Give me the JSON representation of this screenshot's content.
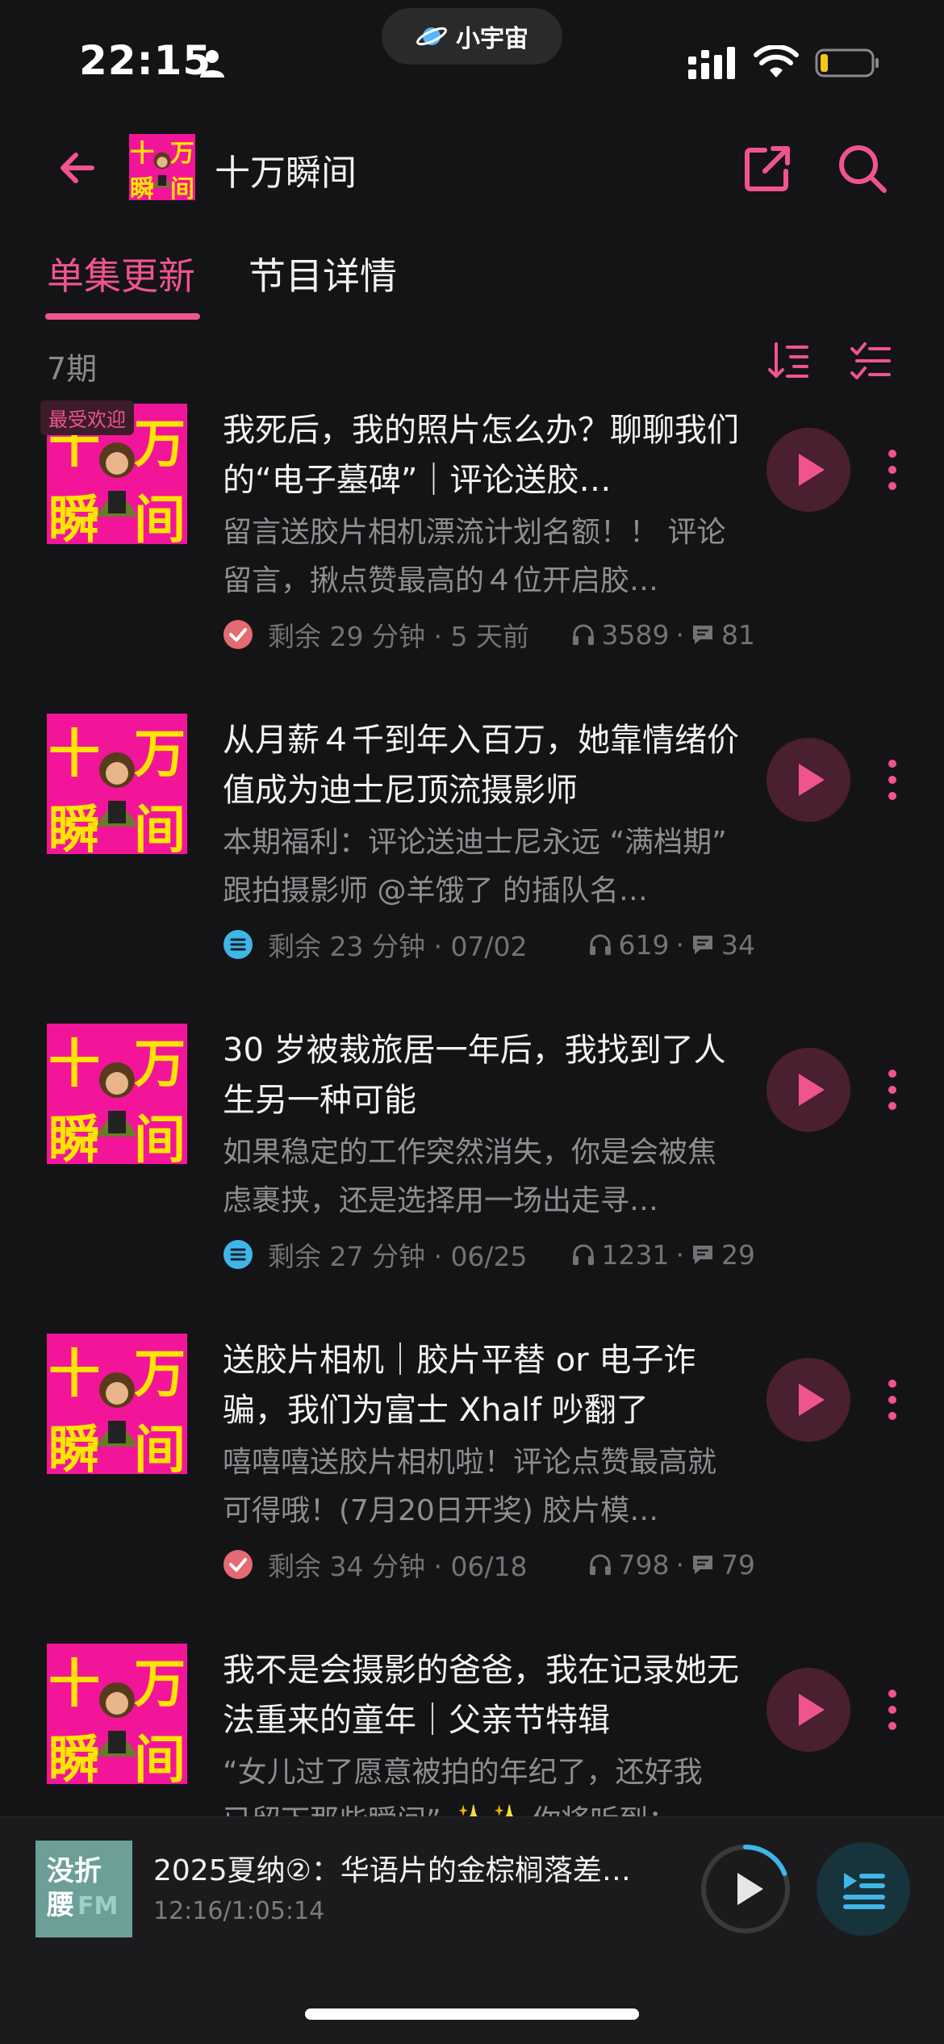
{
  "status_bar": {
    "time": "22:15",
    "island_label": "小宇宙"
  },
  "header": {
    "title": "十万瞬间",
    "logo_text": [
      "十",
      "万",
      "瞬",
      "间"
    ]
  },
  "tabs": [
    {
      "label": "单集更新",
      "active": true
    },
    {
      "label": "节目详情",
      "active": false
    }
  ],
  "episode_count": "7期",
  "accent_color": "#f0548e",
  "episodes": [
    {
      "badge": "最受欢迎",
      "title": "我死后，我的照片怎么办？聊聊我们的“电子墓碑”｜评论送胶…",
      "desc": "留言送胶片相机漂流计划名额！！ 评论留言，揪点赞最高的４位开启胶…",
      "status": "check",
      "remain": "剩余 29 分钟 · 5 天前",
      "plays": "3589",
      "comments": "81"
    },
    {
      "title": "从月薪４千到年入百万，她靠情绪价值成为迪士尼顶流摄影师",
      "desc": "本期福利：评论送迪士尼永远 “满档期” 跟拍摄影师 @羊饿了 的插队名…",
      "status": "list",
      "remain": "剩余 23 分钟 · 07/02",
      "plays": "619",
      "comments": "34"
    },
    {
      "title": "30 岁被裁旅居一年后，我找到了人生另一种可能",
      "desc": "如果稳定的工作突然消失，你是会被焦虑裹挟，还是选择用一场出走寻…",
      "status": "list",
      "remain": "剩余 27 分钟 · 06/25",
      "plays": "1231",
      "comments": "29"
    },
    {
      "title": "送胶片相机｜胶片平替 or 电子诈骗，我们为富士 Xhalf 吵翻了",
      "desc": "嘻嘻嘻送胶片相机啦！评论点赞最高就可得哦！(7月20日开奖) 胶片模…",
      "status": "check",
      "remain": "剩余 34 分钟 · 06/18",
      "plays": "798",
      "comments": "79"
    },
    {
      "title": "我不是会摄影的爸爸，我在记录她无法重来的童年｜父亲节特辑",
      "desc": "“女儿过了愿意被拍的年纪了，还好我已留下那些瞬间” ✨✨ 你将听到：",
      "status": "",
      "remain": "",
      "plays": "",
      "comments": ""
    }
  ],
  "player": {
    "cover_text": [
      "没折",
      "腰"
    ],
    "cover_sub": "FM",
    "title": "2025夏纳②：华语片的金棕榈落差…",
    "progress": "12:16/1:05:14",
    "progress_fraction": 0.19
  }
}
